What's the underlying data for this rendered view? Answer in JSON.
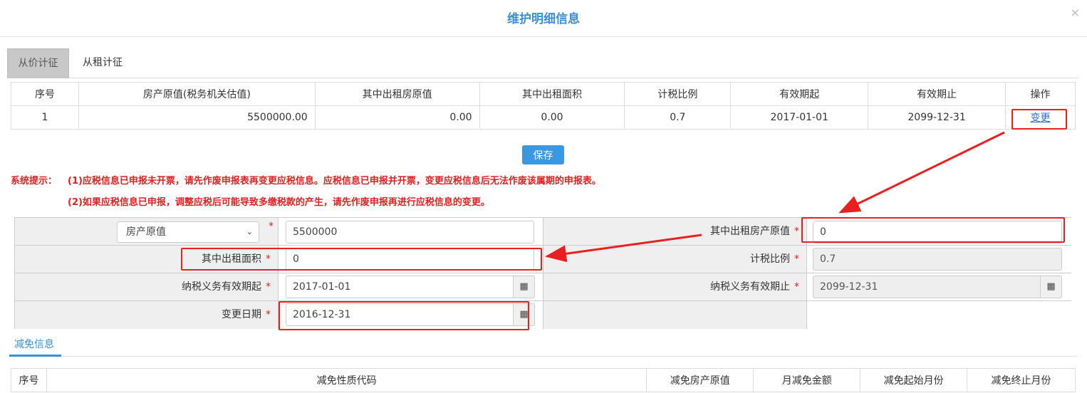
{
  "modal": {
    "title": "维护明细信息",
    "close": "×"
  },
  "tabs": [
    {
      "label": "从价计征"
    },
    {
      "label": "从租计征"
    }
  ],
  "main_table": {
    "headers": [
      "序号",
      "房产原值(税务机关估值)",
      "其中出租房原值",
      "其中出租面积",
      "计税比例",
      "有效期起",
      "有效期止",
      "操作"
    ],
    "rows": [
      {
        "seq": "1",
        "orig_value": "5500000.00",
        "rent_orig": "0.00",
        "rent_area": "0.00",
        "ratio": "0.7",
        "start": "2017-01-01",
        "end": "2099-12-31",
        "action": "变更"
      }
    ]
  },
  "save_button": "保存",
  "tips": {
    "label": "系统提示：",
    "line1": "(1)应税信息已申报未开票，请先作废申报表再变更应税信息。应税信息已申报并开票，变更应税信息后无法作废该属期的申报表。",
    "line2": "(2)如果应税信息已申报，调整应税后可能导致多缴税款的产生，请先作废申报再进行应税信息的变更。"
  },
  "form": {
    "select_value": "房产原值",
    "orig_value": "5500000",
    "rent_orig_label": "其中出租房产原值",
    "rent_orig_value": "0",
    "rent_area_label": "其中出租面积",
    "rent_area_value": "0",
    "ratio_label": "计税比例",
    "ratio_value": "0.7",
    "start_label": "纳税义务有效期起",
    "start_value": "2017-01-01",
    "end_label": "纳税义务有效期止",
    "end_value": "2099-12-31",
    "change_date_label": "变更日期",
    "change_date_value": "2016-12-31",
    "required_mark": "*",
    "calendar_icon": "▦"
  },
  "relief": {
    "tab_label": "减免信息",
    "headers": [
      "序号",
      "减免性质代码",
      "减免房产原值",
      "月减免金额",
      "减免起始月份",
      "减免终止月份"
    ]
  },
  "annotation_color": "#e8201f"
}
